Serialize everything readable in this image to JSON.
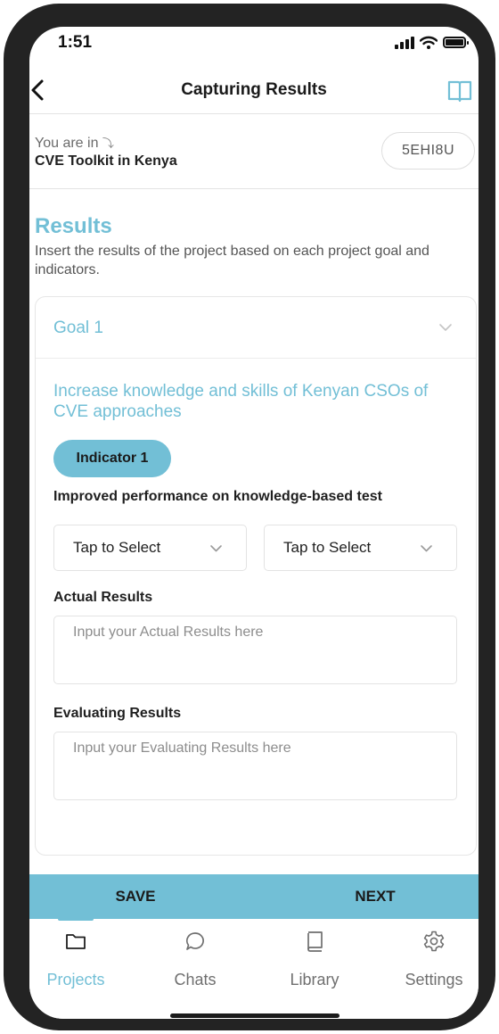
{
  "status_bar": {
    "time": "1:51"
  },
  "header": {
    "title": "Capturing Results"
  },
  "context": {
    "prefix": "You are in",
    "project_name": "CVE Toolkit in Kenya",
    "code": "5EHI8U"
  },
  "section": {
    "title": "Results",
    "description": "Insert the results of the project based on each project goal and indicators."
  },
  "goal": {
    "label": "Goal 1",
    "text": "Increase knowledge and skills of Kenyan CSOs of CVE approaches",
    "indicator": {
      "label": "Indicator 1",
      "description": "Improved performance on knowledge-based test"
    },
    "selects": [
      {
        "value": "Tap to Select"
      },
      {
        "value": "Tap to Select"
      }
    ],
    "actual_results": {
      "label": "Actual Results",
      "placeholder": "Input your Actual Results here"
    },
    "evaluating_results": {
      "label": "Evaluating Results",
      "placeholder": "Input your Evaluating Results here"
    }
  },
  "actions": {
    "save": "SAVE",
    "next": "NEXT"
  },
  "tabs": [
    {
      "label": "Projects",
      "icon": "folder-icon",
      "active": true
    },
    {
      "label": "Chats",
      "icon": "chat-bubble-icon",
      "active": false
    },
    {
      "label": "Library",
      "icon": "book-icon",
      "active": false
    },
    {
      "label": "Settings",
      "icon": "gear-icon",
      "active": false
    }
  ],
  "colors": {
    "accent": "#72bfd6",
    "frame": "#232323"
  }
}
